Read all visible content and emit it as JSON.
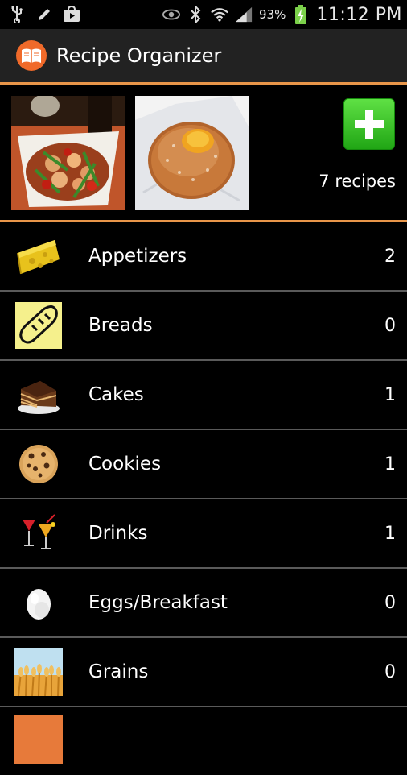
{
  "status_bar": {
    "left_icons": [
      "usb-icon",
      "pencil-icon",
      "play-store-icon"
    ],
    "right_icons": [
      "eye-icon",
      "bluetooth-icon",
      "wifi-icon",
      "signal-icon",
      "battery-charging-icon"
    ],
    "battery_percent": "93%",
    "time": "11:12 PM"
  },
  "action_bar": {
    "title": "Recipe Organizer",
    "icon": "book-icon",
    "accent_color": "#e8964a"
  },
  "header": {
    "recipe_count": "7 recipes",
    "add_icon": "plus-icon",
    "photos": [
      "stir-fry-photo",
      "doughnut-photo"
    ]
  },
  "categories": [
    {
      "label": "Appetizers",
      "count": "2",
      "icon": "cheese-icon"
    },
    {
      "label": "Breads",
      "count": "0",
      "icon": "bread-icon"
    },
    {
      "label": "Cakes",
      "count": "1",
      "icon": "cake-icon"
    },
    {
      "label": "Cookies",
      "count": "1",
      "icon": "cookie-icon"
    },
    {
      "label": "Drinks",
      "count": "1",
      "icon": "drinks-icon"
    },
    {
      "label": "Eggs/Breakfast",
      "count": "0",
      "icon": "egg-icon"
    },
    {
      "label": "Grains",
      "count": "0",
      "icon": "wheat-icon"
    }
  ]
}
